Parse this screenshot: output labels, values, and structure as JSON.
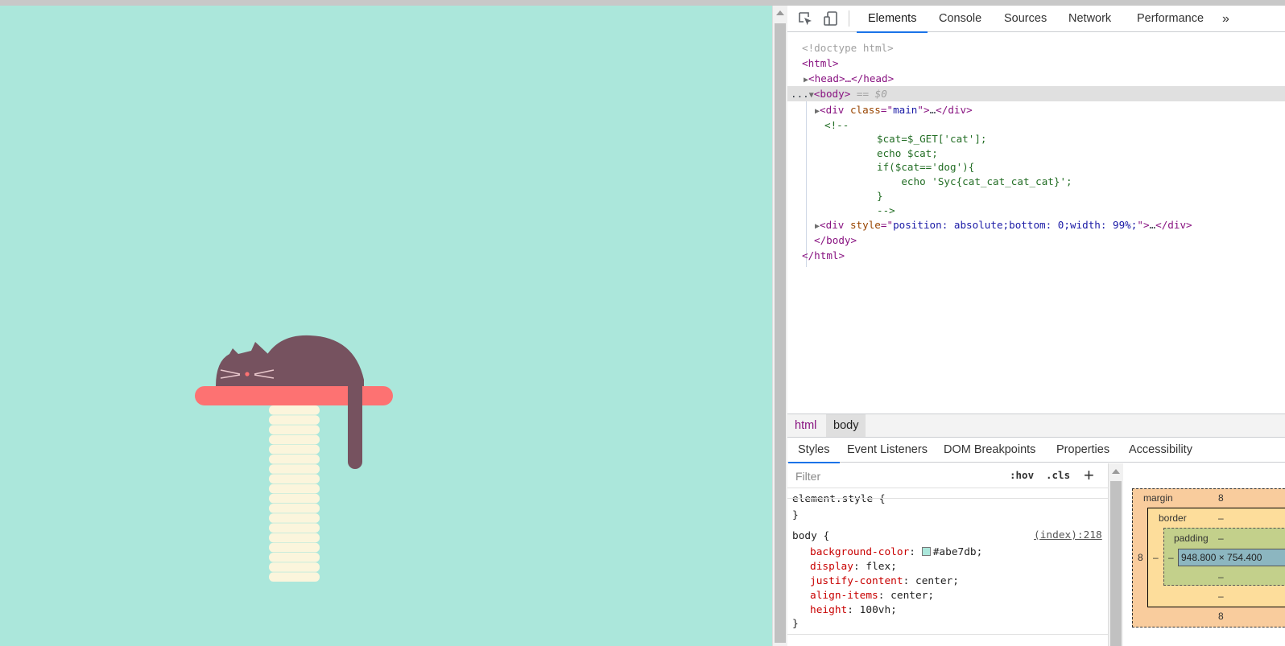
{
  "devtools": {
    "tabs": [
      "Elements",
      "Console",
      "Sources",
      "Network",
      "Performance"
    ],
    "more_tabs": "»",
    "dom": {
      "doctype": "<!doctype html>",
      "html_open": "<html>",
      "head_line": "<head>…</head>",
      "body_open": "<body>",
      "body_selected_marker": "== $0",
      "ellipsis": "...",
      "div_main_tag": "div",
      "div_main_attr": "class",
      "div_main_value": "main",
      "comment_open": "<!--",
      "comment_lines": [
        "$cat=$_GET['cat'];",
        "echo $cat;",
        "if($cat=='dog'){",
        "    echo 'Syc{cat_cat_cat_cat}';",
        "}",
        "-->"
      ],
      "div2_tag": "div",
      "div2_attr": "style",
      "div2_value": "position: absolute;bottom: 0;width: 99%;",
      "body_close": "</body>",
      "html_close": "</html>"
    },
    "breadcrumbs": [
      "html",
      "body"
    ],
    "subtabs": [
      "Styles",
      "Event Listeners",
      "DOM Breakpoints",
      "Properties",
      "Accessibility"
    ],
    "styles": {
      "filter_placeholder": "Filter",
      "hov": ":hov",
      "cls": ".cls",
      "plus": "+",
      "element_style_open": "element.style {",
      "element_style_close": "}",
      "body_selector": "body {",
      "source": "(index):218",
      "props": [
        {
          "name": "background-color",
          "value": "#abe7db;"
        },
        {
          "name": "display",
          "value": "flex;"
        },
        {
          "name": "justify-content",
          "value": "center;"
        },
        {
          "name": "align-items",
          "value": "center;"
        },
        {
          "name": "height",
          "value": "100vh;"
        }
      ],
      "body_close": "}"
    },
    "box_model": {
      "margin_label": "margin",
      "margin_top": "8",
      "margin_bottom": "8",
      "margin_left": "8",
      "border_label": "border",
      "border_top": "–",
      "border_bottom": "–",
      "border_left": "–",
      "padding_label": "padding",
      "padding_top": "–",
      "padding_bottom": "–",
      "padding_left": "–",
      "content_size": "948.800 × 754.400"
    }
  },
  "colors": {
    "page_bg": "#abe7db",
    "cat": "#76525f",
    "shelf": "#fd7272",
    "post": "#fbf5dc"
  }
}
